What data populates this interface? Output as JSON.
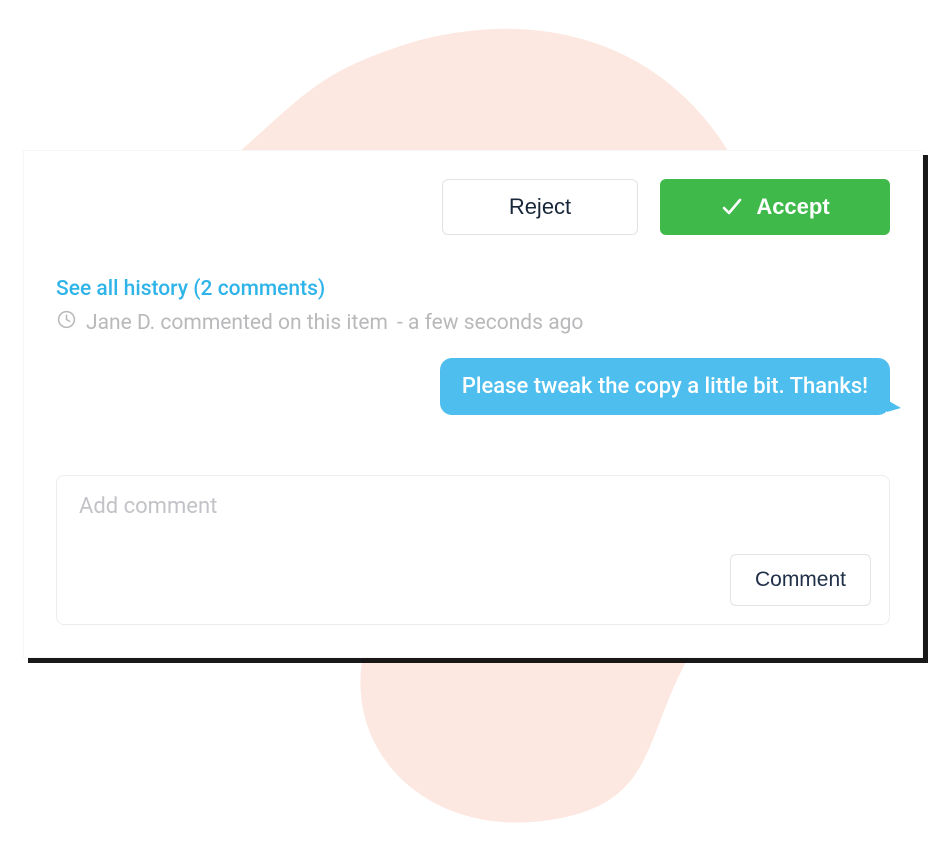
{
  "actions": {
    "reject_label": "Reject",
    "accept_label": "Accept"
  },
  "history": {
    "link_text": "See all history (2 comments)",
    "meta_user_action": "Jane D. commented on this item",
    "meta_timestamp": "a few seconds ago"
  },
  "messages": [
    {
      "text": "Please tweak the copy a little bit. Thanks!"
    }
  ],
  "comment_box": {
    "placeholder": "Add comment",
    "value": "",
    "submit_label": "Comment"
  },
  "colors": {
    "accent_blue": "#4ebeee",
    "accept_green": "#3fba4a",
    "link_blue": "#2fb4e9",
    "blob": "#fce8e0",
    "muted": "#b9b9bb",
    "dark_text": "#18273a"
  }
}
